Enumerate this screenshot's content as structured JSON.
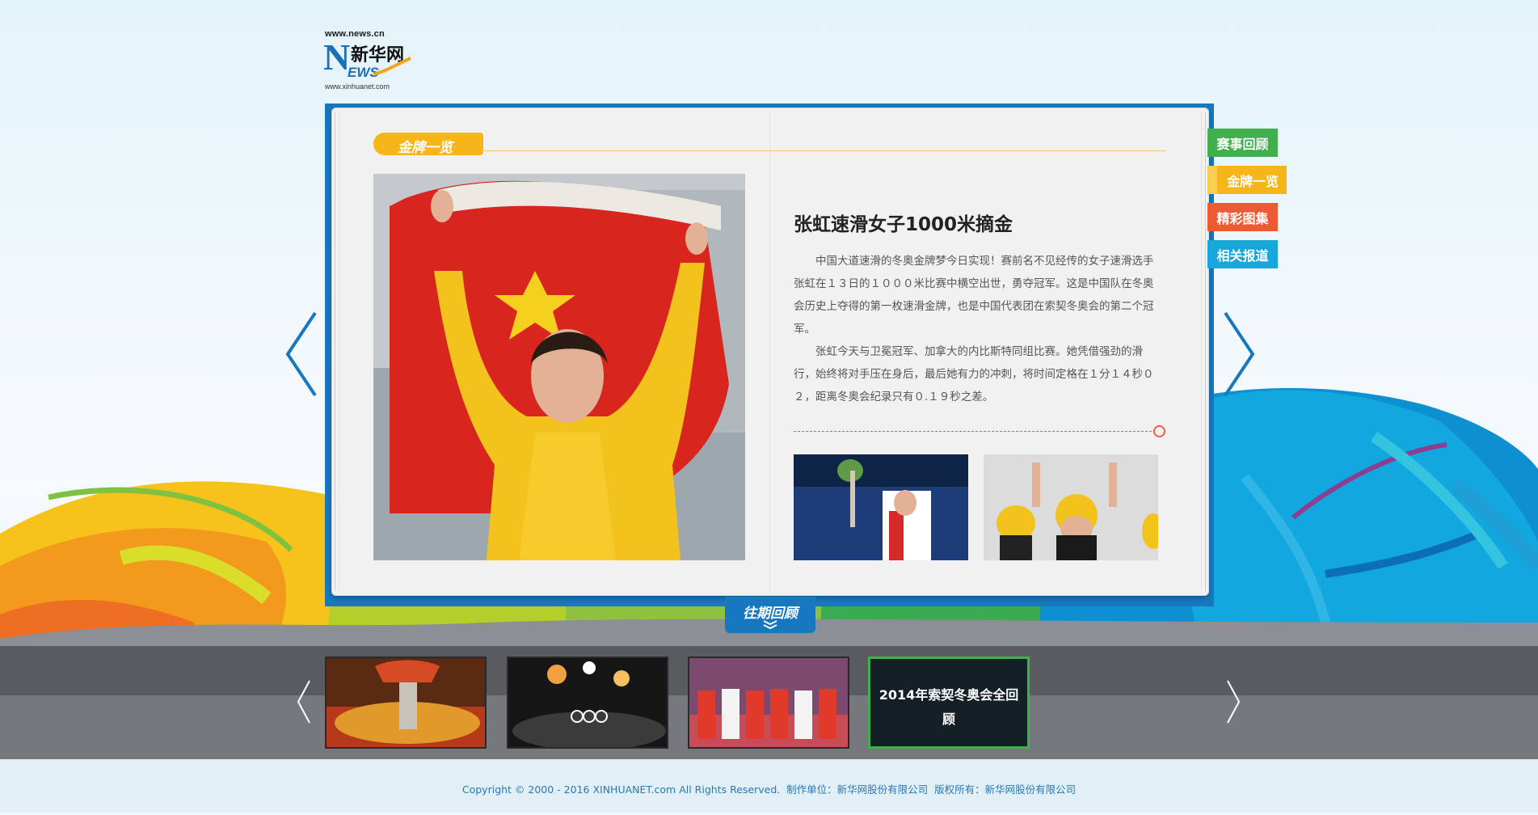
{
  "logo": {
    "url_top": "www.news.cn",
    "n_letter": "N",
    "chinese_name": "新华网",
    "ews": "EWS",
    "url_bottom": "www.xinhuanet.com"
  },
  "section": {
    "title": "金牌一览"
  },
  "article": {
    "title": "张虹速滑女子1000米摘金",
    "paragraphs": [
      "中国大道速滑的冬奥金牌梦今日实现！赛前名不见经传的女子速滑选手张虹在１３日的１０００米比赛中横空出世，勇夺冠军。这是中国队在冬奥会历史上夺得的第一枚速滑金牌，也是中国代表团在索契冬奥会的第二个冠军。",
      "张虹今天与卫冕冠军、加拿大的内比斯特同组比赛。她凭借强劲的滑行，始终将对手压在身后，最后她有力的冲刺，将时间定格在１分１４秒０２，距离冬奥会纪录只有０.１９秒之差。"
    ]
  },
  "side_nav": {
    "items": [
      {
        "label": "赛事回顾",
        "color": "#3fb04b"
      },
      {
        "label": "金牌一览",
        "color": "#f6b619"
      },
      {
        "label": "精彩图集",
        "color": "#ee5a33"
      },
      {
        "label": "相关报道",
        "color": "#19a6dd"
      }
    ]
  },
  "archive": {
    "label": "往期回顾"
  },
  "strip": {
    "items": [
      {
        "caption": ""
      },
      {
        "caption": ""
      },
      {
        "caption": ""
      },
      {
        "caption": "2014年索契冬奥会全回顾"
      }
    ]
  },
  "footer": {
    "text": "Copyright © 2000 - 2016 XINHUANET.com All Rights Reserved.  制作单位：新华网股份有限公司  版权所有：新华网股份有限公司"
  },
  "icons": {
    "nav_left": "chevron-left-icon",
    "nav_right": "chevron-right-icon",
    "archive": "double-chevron-down-icon"
  },
  "colors": {
    "frame_blue": "#1778c0",
    "accent_yellow": "#f6b619",
    "accent_red": "#e2624a",
    "footer_text": "#2a78b7"
  }
}
